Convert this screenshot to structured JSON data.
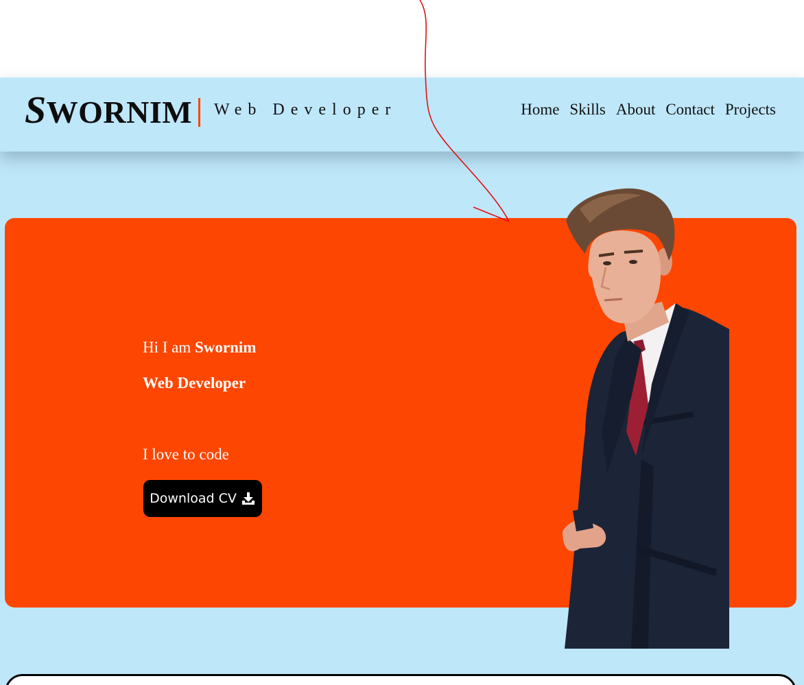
{
  "header": {
    "logo_first": "S",
    "logo_rest": "WORNIM",
    "tagline": "Web Developer",
    "nav": [
      {
        "label": "Home"
      },
      {
        "label": "Skills"
      },
      {
        "label": "About"
      },
      {
        "label": "Contact"
      },
      {
        "label": "Projects"
      }
    ]
  },
  "hero": {
    "intro_prefix": "Hi I am ",
    "name": "Swornim",
    "role": "Web Developer",
    "tagline": "I love to code",
    "button_label": "Download CV",
    "button_icon": "download-icon"
  },
  "colors": {
    "page_background": "#bfe7fa",
    "accent": "#fd4601",
    "button": "#000000",
    "annotation_arrow": "#e01010"
  }
}
